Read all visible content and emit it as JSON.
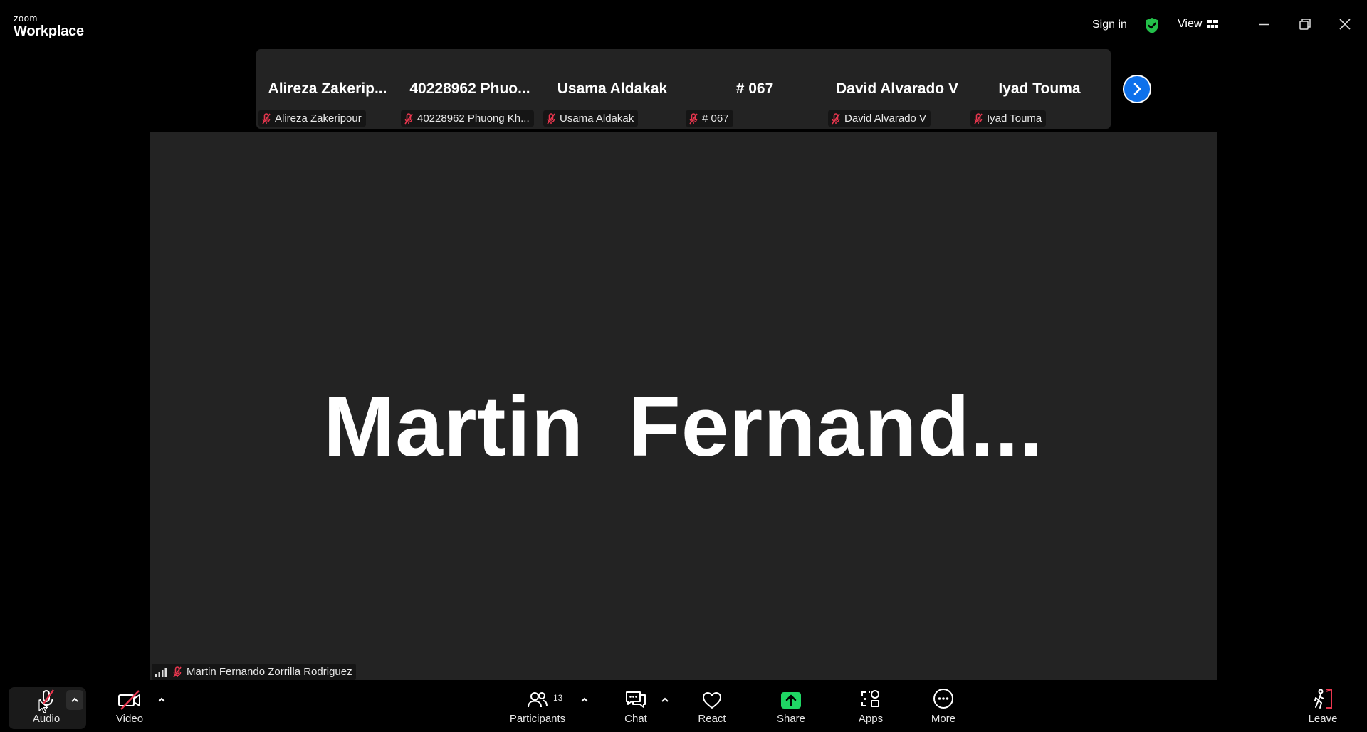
{
  "app": {
    "logo_top": "zoom",
    "logo_bottom": "Workplace",
    "sign_in": "Sign in",
    "view": "View"
  },
  "thumbnails": [
    {
      "display": "Alireza  Zakerip...",
      "tag": "Alireza Zakeripour"
    },
    {
      "display": "40228962  Phuo...",
      "tag": "40228962 Phuong Kh..."
    },
    {
      "display": "Usama Aldakak",
      "tag": "Usama Aldakak"
    },
    {
      "display": "# 067",
      "tag": "# 067"
    },
    {
      "display": "David Alvarado V",
      "tag": "David Alvarado V"
    },
    {
      "display": "Iyad Touma",
      "tag": "Iyad Touma"
    }
  ],
  "main_video": {
    "display_name": "Martin  Fernand...",
    "full_name": "Martin Fernando Zorrilla Rodriguez"
  },
  "toolbar": {
    "audio": "Audio",
    "video": "Video",
    "participants": "Participants",
    "participant_count": "13",
    "chat": "Chat",
    "react": "React",
    "share": "Share",
    "apps": "Apps",
    "more": "More",
    "leave": "Leave"
  },
  "colors": {
    "accent_blue": "#0e71eb",
    "muted_red": "#e8364e",
    "share_green": "#1fd664",
    "shield_green": "#23c04a"
  }
}
